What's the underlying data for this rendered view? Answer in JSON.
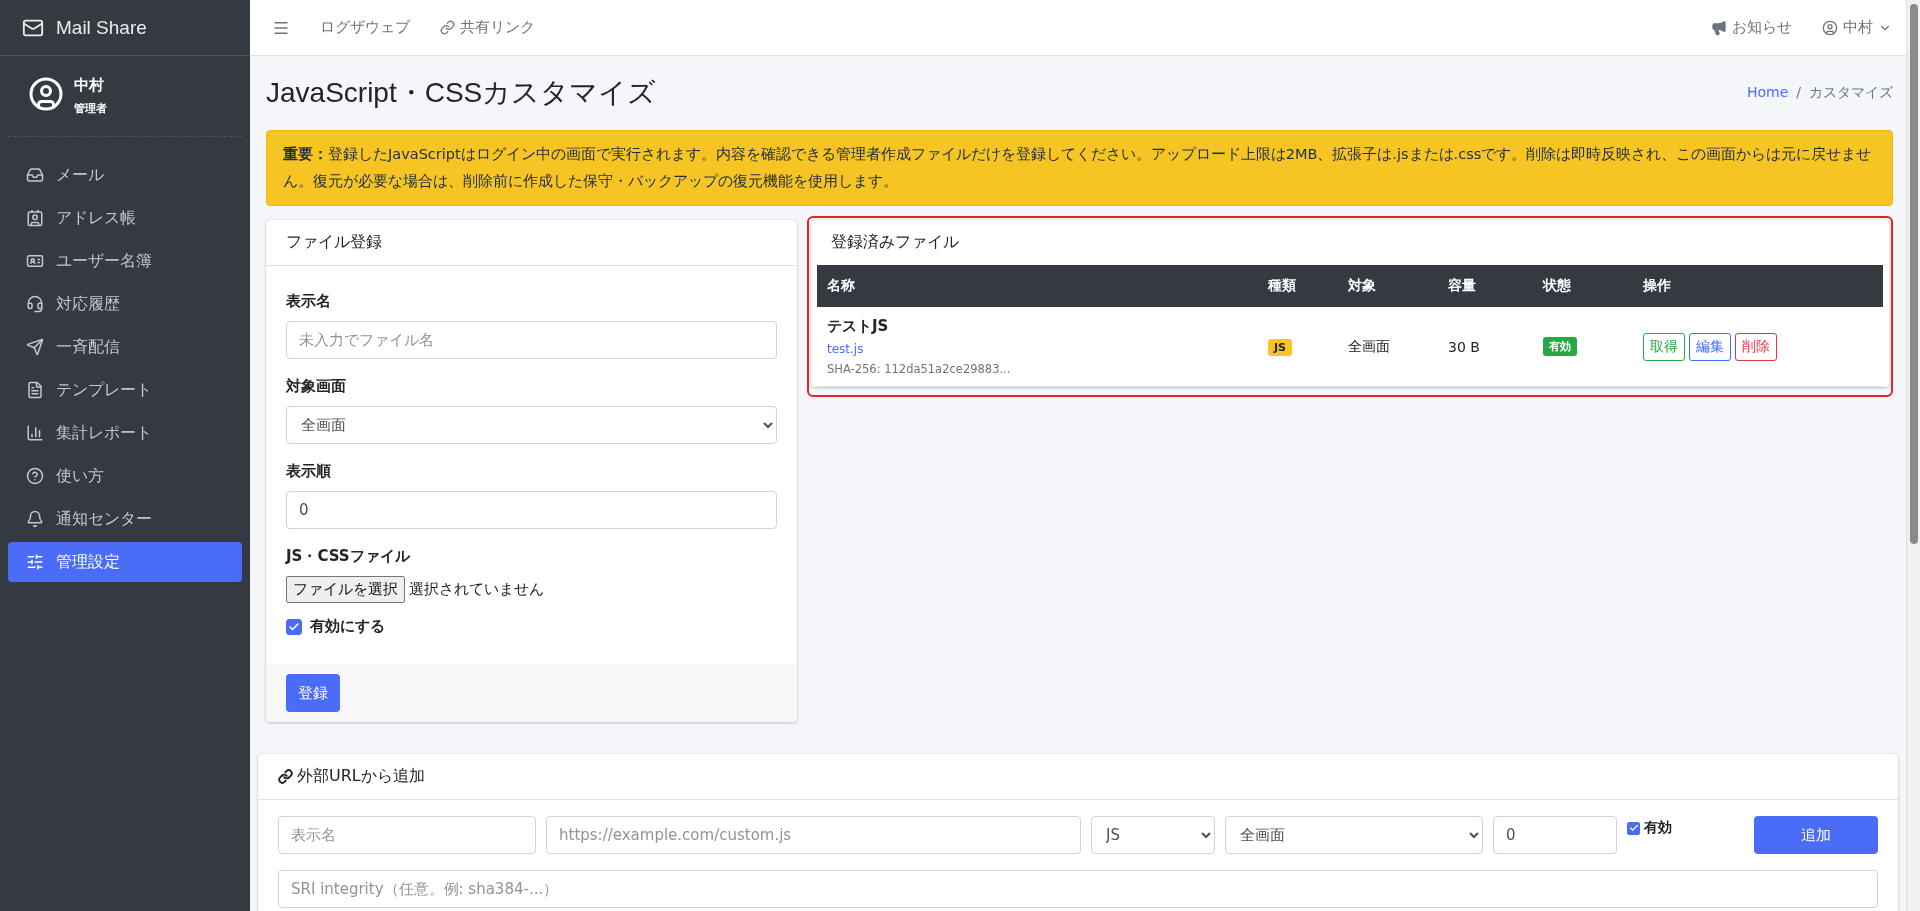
{
  "sidebar": {
    "brand": "Mail Share",
    "user": {
      "name": "中村",
      "role": "管理者"
    },
    "items": [
      {
        "label": "メール",
        "selected": false
      },
      {
        "label": "アドレス帳",
        "selected": false
      },
      {
        "label": "ユーザー名簿",
        "selected": false
      },
      {
        "label": "対応履歴",
        "selected": false
      },
      {
        "label": "一斉配信",
        "selected": false
      },
      {
        "label": "テンプレート",
        "selected": false
      },
      {
        "label": "集計レポート",
        "selected": false
      },
      {
        "label": "使い方",
        "selected": false
      },
      {
        "label": "通知センター",
        "selected": false
      },
      {
        "label": "管理設定",
        "selected": true
      }
    ]
  },
  "topbar": {
    "links": [
      "ログザウェブ",
      "共有リンク"
    ],
    "notice": "お知らせ",
    "user": "中村"
  },
  "page": {
    "title": "JavaScript・CSSカスタマイズ",
    "breadcrumb": [
      {
        "label": "Home",
        "kind": "link"
      },
      {
        "label": "/",
        "kind": "separator"
      },
      {
        "label": "カスタマイズ",
        "kind": "current"
      }
    ]
  },
  "alert": "**重要：**登録したJavaScriptはログイン中の画面で実行されます。内容を確認できる管理者作成ファイルだけを登録してください。アップロード上限は2MB、拡張子は.jsまたは.cssです。削除は即時反映され、この画面からは元に戻せません。復元が必要な場合は、削除前に作成した保守・バックアップの復元機能を使用します。",
  "file_form": {
    "title": "ファイル登録",
    "display_name": {
      "label": "表示名",
      "placeholder": "未入力でファイル名"
    },
    "target": {
      "label": "対象画面",
      "value": "全画面"
    },
    "order": {
      "label": "表示順",
      "value": "0"
    },
    "file": {
      "label": "JS・CSSファイル",
      "button": "ファイルを選択",
      "status": "選択されていません"
    },
    "enabled": {
      "label": "有効にする",
      "checked": true
    },
    "submit": "登録"
  },
  "files_card": {
    "title": "登録済みファイル",
    "highlighted": true,
    "columns": [
      "名称",
      "種類",
      "対象",
      "容量",
      "状態",
      "操作"
    ],
    "rows": [
      {
        "name": "テストJS",
        "filename": "test.js",
        "hash": "SHA-256: 112da51a2ce29883...",
        "type": "JS",
        "target": "全画面",
        "size": "30 B",
        "status": "有効",
        "actions": [
          {
            "label": "取得",
            "color": "#28a745"
          },
          {
            "label": "編集",
            "color": "#3d6bff"
          },
          {
            "label": "削除",
            "color": "#dc3545"
          }
        ]
      }
    ]
  },
  "external": {
    "title": "外部URLから追加",
    "name_placeholder": "表示名",
    "url_placeholder": "https://example.com/custom.js",
    "type": "JS",
    "target": "全画面",
    "order": "0",
    "enabled": {
      "label": "有効",
      "checked": true
    },
    "add": "追加",
    "sri_placeholder": "SRI integrity（任意。例: sha384-...）"
  }
}
